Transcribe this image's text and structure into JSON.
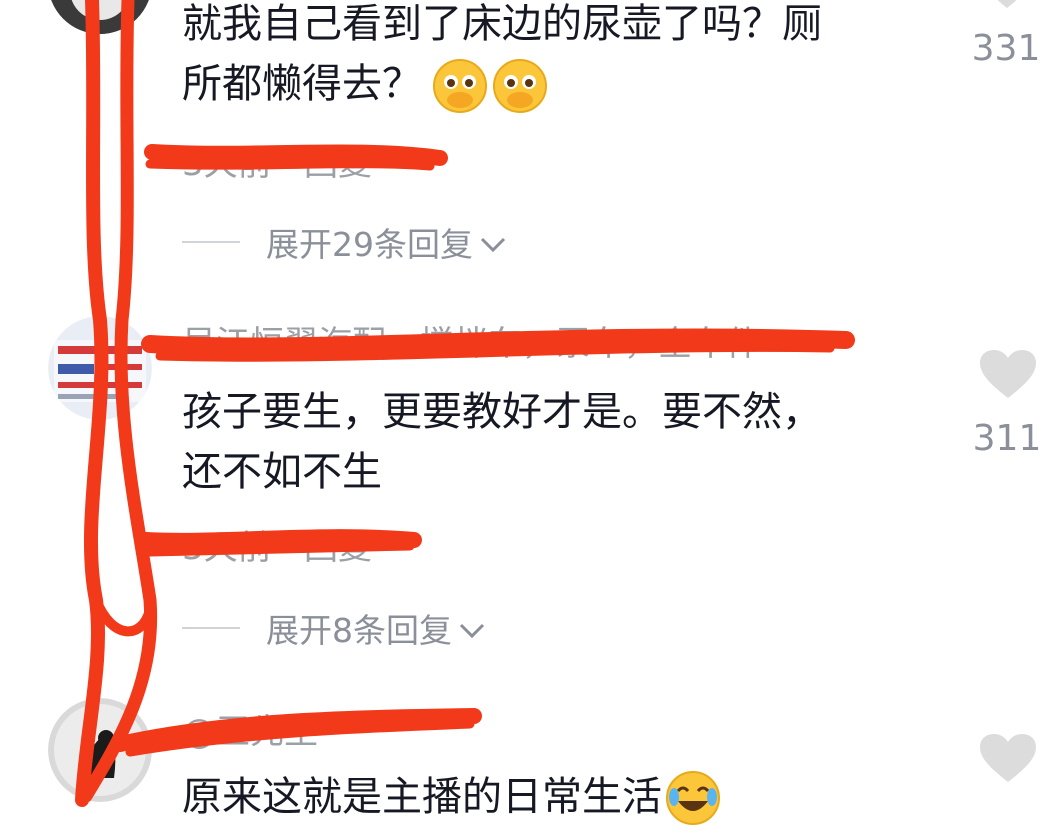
{
  "comments": [
    {
      "text_line1": "就我自己看到了床边的尿壶了吗？厕",
      "text_line2": "所都懒得去？",
      "emoji": "pleading-face-hands-over-mouth",
      "meta": "3天前 · 回复",
      "likes": "331",
      "expand_label": "展开29条回复"
    },
    {
      "username": "吴江恒翠汽配，搅拌车，泵车，全车件",
      "text_line1": "孩子要生，更要教好才是。要不然，",
      "text_line2": "还不如不生",
      "meta": "3天前 · 回复",
      "likes": "311",
      "expand_label": "展开8条回复"
    },
    {
      "username": "@王先生",
      "text_line1": "原来这就是主播的日常生活",
      "emoji": "rolling-on-floor-laughing"
    }
  ],
  "colors": {
    "scribble": "#f23a1a",
    "text": "#161823",
    "muted": "#8a8f99",
    "heart": "#dcdcdc"
  }
}
